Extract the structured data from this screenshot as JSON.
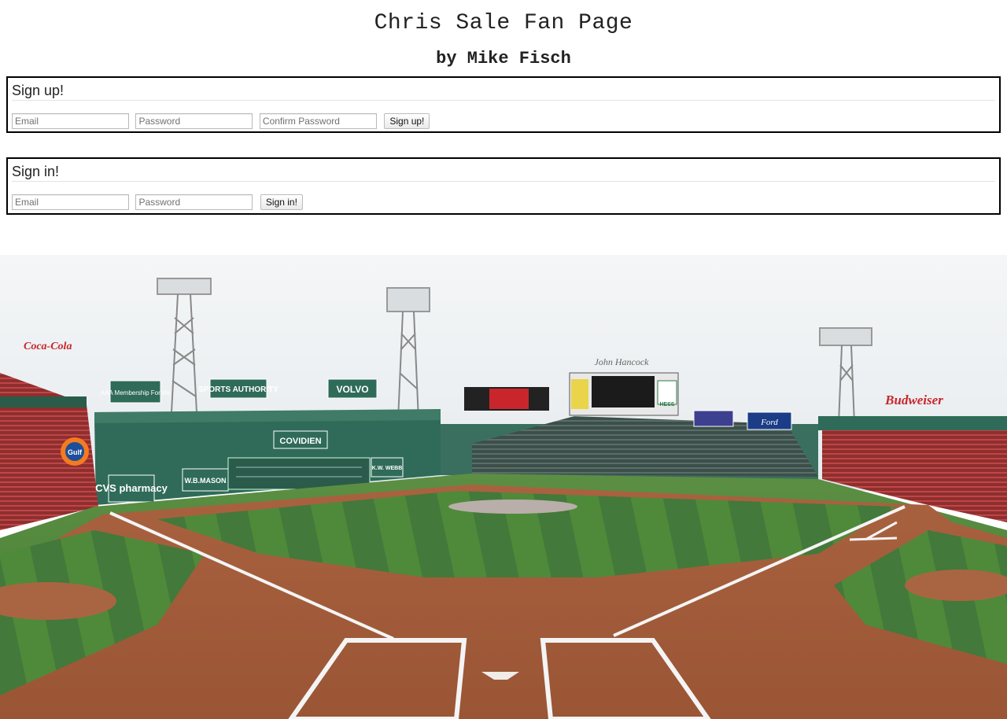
{
  "header": {
    "title": "Chris Sale Fan Page",
    "subtitle": "by Mike Fisch"
  },
  "signup": {
    "heading": "Sign up!",
    "email_placeholder": "Email",
    "password_placeholder": "Password",
    "confirm_placeholder": "Confirm Password",
    "button_label": "Sign up!"
  },
  "signin": {
    "heading": "Sign in!",
    "email_placeholder": "Email",
    "password_placeholder": "Password",
    "button_label": "Sign in!"
  },
  "banner": {
    "signs": {
      "aaa": "AAA Membership For life",
      "sports": "SPORTS AUTHORITY",
      "volvo": "VOLVO",
      "covidien": "COVIDIEN",
      "cvs": "CVS pharmacy",
      "wbmason": "W.B.MASON",
      "kwwebb": "K.W. WEBB",
      "gulf": "Gulf",
      "budweiser": "Budweiser",
      "ford": "Ford",
      "hess": "HESS",
      "coke": "Coca-Cola",
      "hancock": "John Hancock"
    },
    "colors": {
      "wall": "#2f6b58",
      "grass": "#4a8a3c",
      "dirt": "#b06a45",
      "sky": "#eef1f3",
      "seats": "#b23a3a"
    }
  }
}
